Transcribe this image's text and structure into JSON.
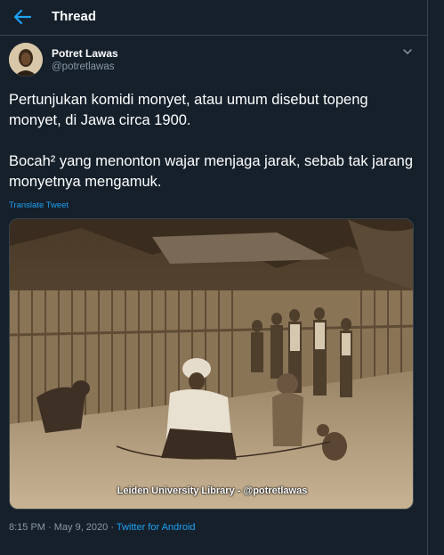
{
  "header": {
    "title": "Thread"
  },
  "tweet": {
    "author_name": "Potret Lawas",
    "author_handle": "@potretlawas",
    "text": "Pertunjukan komidi monyet, atau umum disebut topeng monyet, di Jawa circa 1900.\n\nBocah² yang menonton wajar menjaga jarak, sebab tak jarang monyetnya mengamuk.",
    "translate_label": "Translate Tweet",
    "photo_caption": "Leiden University Library - @potretlawas",
    "timestamp": "8:15 PM · May 9, 2020 · ",
    "source": "Twitter for Android"
  },
  "icons": {
    "back": "arrow-left-icon",
    "more": "chevron-down-icon"
  },
  "colors": {
    "background": "#15202b",
    "accent": "#1da1f2",
    "secondary_text": "#8899a6",
    "border": "#38444d"
  }
}
